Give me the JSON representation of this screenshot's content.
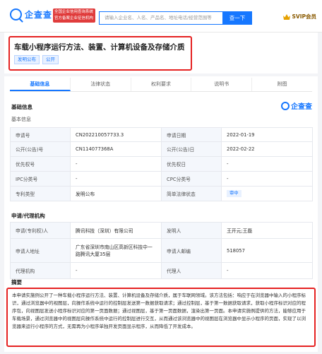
{
  "header": {
    "logo_text": "企查查",
    "logo_tag": "全国企业信用查询系统 官方备案企业征信机构",
    "search_placeholder": "请输入企业名、人名、产品名、地址电话/经营范围等",
    "search_button": "查一下",
    "vip_label": "SVIP会员"
  },
  "title": {
    "text": "车载小程序运行方法、装置、计算机设备及存储介质",
    "badges": [
      "发明公布",
      "公开"
    ]
  },
  "tabs": [
    "基础信息",
    "法律状态",
    "权利要求",
    "说明书",
    "附图"
  ],
  "basic_info": {
    "section_title": "基础信息",
    "brand": "企查查",
    "subsection": "基本信息",
    "rows": [
      [
        "申请号",
        "CN202210057733.3",
        "申请日期",
        "2022-01-19"
      ],
      [
        "公开(公告)号",
        "CN114077368A",
        "公开(公告)日",
        "2022-02-22"
      ],
      [
        "优先权号",
        "-",
        "优先权日",
        "-"
      ],
      [
        "IPC分类号",
        "-",
        "CPC分类号",
        "-"
      ],
      [
        "专利类型",
        "发明公布",
        "简单法律状态",
        "审中"
      ]
    ]
  },
  "applicant": {
    "section_title": "申请/代理机构",
    "rows": [
      [
        "申请(专利权)人",
        "腾讯科技（深圳）有限公司",
        "发明人",
        "王开元;王磊"
      ],
      [
        "申请人地址",
        "广东省深圳市南山区高新区科技中一路腾讯大厦35层",
        "申请人邮编",
        "518057"
      ],
      [
        "代理机构",
        "-",
        "代理人",
        "-"
      ]
    ]
  },
  "abstract": {
    "section_title": "摘要",
    "text": "本申请实施例公开了一种车载小程序运行方法、装置、计算机设备及存储介质，属于车联网领域。该方法包括：响应于在浏览器中输入的小程序标识，通过浏览器中的视图层，向操作系统中运行的控制层发送第一数据获取请求；通过控制层，基于第一数据获取请求，获取小程序标识对应的程序包，向视图层发送小程序标识对应的第一页面数据；通过视图层，基于第一页面数据，渲染出第一页面。本申请实施例提供的方法，能够应用于车载场景，通过浏览器中的视图层向操作系统中运行的控制层进行交互，从而通过该浏览器中的视图层在浏览器中显示小程序的页面，实现了以浏览器来运行小程序的方式，无需再为小程序单独开发页面显示程序，从而降低了开发成本。"
  }
}
